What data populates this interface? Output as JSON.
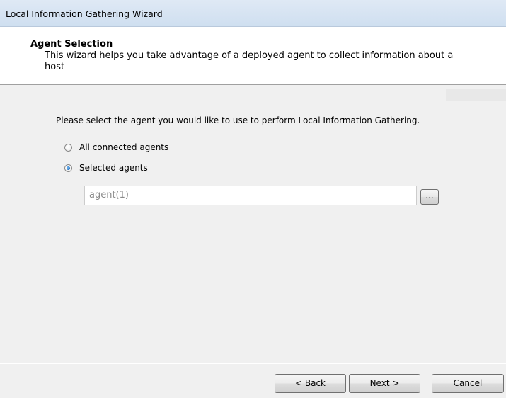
{
  "window": {
    "title": "Local Information Gathering Wizard"
  },
  "header": {
    "title": "Agent Selection",
    "description": "This wizard helps you take advantage of a deployed agent to collect information about a host"
  },
  "content": {
    "instruction": "Please select the agent you would like to use to perform Local Information Gathering.",
    "options": [
      {
        "label": "All connected agents",
        "checked": false
      },
      {
        "label": "Selected agents",
        "checked": true
      }
    ],
    "agent_field_value": "agent(1)",
    "browse_label": "..."
  },
  "footer": {
    "back_label": "< Back",
    "next_label": "Next >",
    "cancel_label": "Cancel"
  }
}
